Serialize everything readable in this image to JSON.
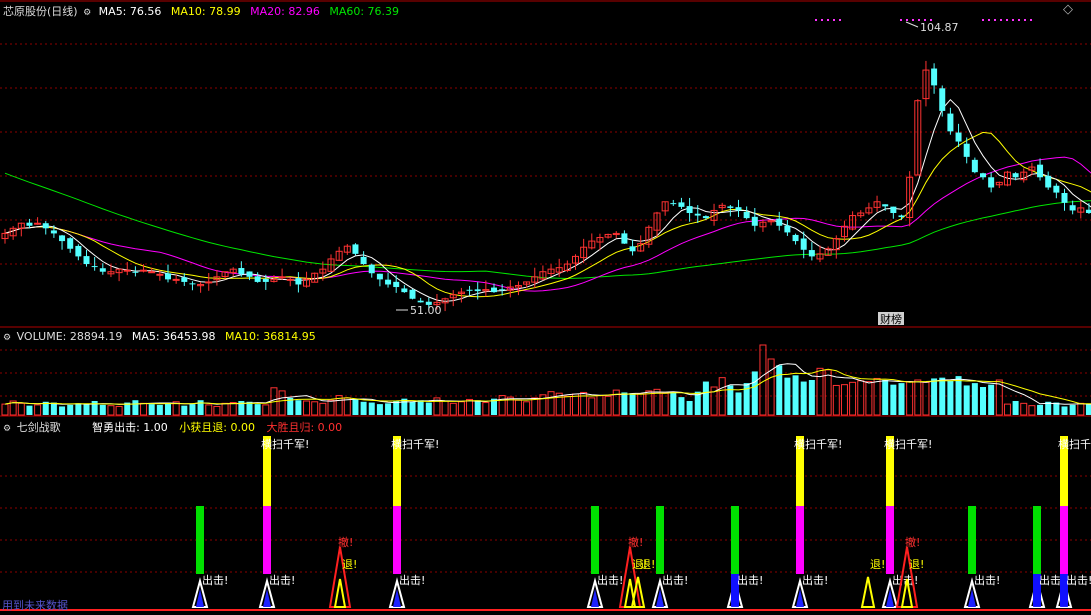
{
  "header": {
    "stock_name": "芯原股份(日线)",
    "ma5": "MA5: 76.56",
    "ma10": "MA10: 78.99",
    "ma20": "MA20: 82.96",
    "ma60": "MA60: 76.39"
  },
  "price_labels": {
    "high": "104.87",
    "low": "51.00",
    "event": "财榜"
  },
  "volume_header": {
    "volume": "VOLUME: 28894.19",
    "ma5": "MA5: 36453.98",
    "ma10": "MA10: 36814.95"
  },
  "indicator_header": {
    "name": "七剑战歌",
    "attack": "智勇出击: 1.00",
    "small_win": "小获且退: 0.00",
    "big_win": "大胜且归: 0.00"
  },
  "signal_texts": {
    "sweep": "横扫千军!",
    "attack": "出击!",
    "retreat": "退!",
    "withdraw": "撤!"
  },
  "footer": {
    "note": "用到未来数据"
  },
  "colors": {
    "up": "#ff3232",
    "down": "#54ffff",
    "ma5": "#ffffff",
    "ma10": "#ffff00",
    "ma20": "#ff00ff",
    "ma60": "#00e600",
    "grid": "#8b0000"
  },
  "icons": {
    "expand": "diamond-icon",
    "settings": "gear-icon"
  },
  "chart_data": {
    "type": "candlestick",
    "price_range": [
      51.0,
      104.87
    ],
    "closes": [
      66,
      67,
      68,
      67.5,
      68,
      67,
      66,
      64.5,
      63,
      61.5,
      60,
      59.5,
      58.5,
      58.5,
      59,
      58.8,
      58.3,
      58.8,
      58.5,
      58,
      57,
      57,
      56.5,
      56.2,
      56,
      56.5,
      57.5,
      58.5,
      59,
      58,
      57.5,
      56.5,
      56.5,
      57,
      57.5,
      57,
      56,
      57,
      58.2,
      59,
      61,
      62.5,
      63.5,
      62,
      60,
      58.2,
      57,
      56,
      55.5,
      54.5,
      53.2,
      52.5,
      52,
      52.5,
      53.2,
      54,
      54.5,
      54.8,
      54.7,
      55,
      54.5,
      55,
      55.5,
      55.8,
      56.5,
      57.5,
      58.5,
      59,
      59.3,
      60,
      61.5,
      63.3,
      64.5,
      65.2,
      65.8,
      66,
      64,
      62.5,
      64,
      67.2,
      70,
      72.2,
      71.8,
      71.2,
      70,
      69.5,
      69,
      70.5,
      71.5,
      71,
      70.5,
      69,
      67.5,
      68.2,
      68.5,
      67.5,
      66.2,
      64.5,
      62.8,
      61.5,
      62,
      63,
      65,
      67.4,
      69.5,
      70,
      71,
      72.2,
      71.3,
      70,
      69.2,
      77,
      92,
      98,
      95,
      90,
      86,
      84,
      81,
      78,
      77,
      75,
      76,
      78,
      77,
      78,
      79,
      77,
      75,
      74,
      72,
      70.5,
      71,
      70,
      68
    ]
  },
  "volume_data": {
    "values": [
      14,
      18,
      15,
      12,
      13,
      17,
      16,
      11,
      13,
      15,
      14,
      18,
      13,
      12,
      11,
      16,
      19,
      15,
      14,
      13,
      16,
      17,
      12,
      14,
      19,
      13,
      11,
      15,
      16,
      18,
      17,
      14,
      13,
      35,
      31,
      22,
      19,
      18,
      17,
      15,
      19,
      25,
      22,
      20,
      17,
      16,
      14,
      15,
      18,
      21,
      17,
      19,
      16,
      22,
      18,
      15,
      17,
      20,
      19,
      16,
      21,
      25,
      23,
      19,
      17,
      22,
      26,
      30,
      28,
      24,
      27,
      29,
      22,
      25,
      24,
      32,
      29,
      28,
      27,
      31,
      33,
      28,
      30,
      23,
      18,
      30,
      43,
      36,
      48,
      38,
      29,
      41,
      56,
      90,
      72,
      64,
      48,
      51,
      43,
      45,
      60,
      58,
      38,
      39,
      42,
      44,
      43,
      47,
      45,
      39,
      41,
      43,
      45,
      42,
      47,
      48,
      44,
      50,
      38,
      41,
      36,
      39,
      45
    ]
  }
}
